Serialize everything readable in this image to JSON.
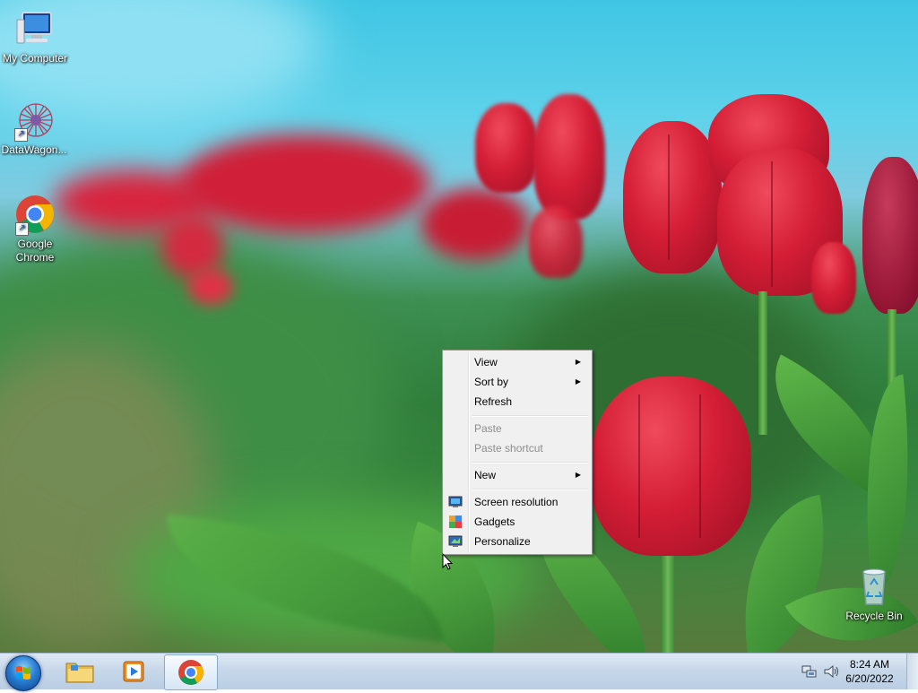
{
  "desktop": {
    "icons": [
      {
        "label": "My Computer",
        "icon": "computer-icon"
      },
      {
        "label": "DataWagon...",
        "icon": "datawagon-icon"
      },
      {
        "label": "Google Chrome",
        "icon": "chrome-icon"
      },
      {
        "label": "Recycle Bin",
        "icon": "recycle-bin-icon"
      }
    ]
  },
  "context_menu": {
    "items": [
      {
        "label": "View",
        "submenu": true,
        "enabled": true
      },
      {
        "label": "Sort by",
        "submenu": true,
        "enabled": true
      },
      {
        "label": "Refresh",
        "submenu": false,
        "enabled": true
      },
      {
        "label": "Paste",
        "submenu": false,
        "enabled": false
      },
      {
        "label": "Paste shortcut",
        "submenu": false,
        "enabled": false
      },
      {
        "label": "New",
        "submenu": true,
        "enabled": true
      },
      {
        "label": "Screen resolution",
        "icon": "monitor-icon",
        "enabled": true
      },
      {
        "label": "Gadgets",
        "icon": "gadgets-icon",
        "enabled": true
      },
      {
        "label": "Personalize",
        "icon": "personalize-icon",
        "enabled": true
      }
    ],
    "submenu_glyph": "▶"
  },
  "taskbar": {
    "pinned": [
      "start-button",
      "file-explorer-icon",
      "media-player-icon",
      "chrome-icon"
    ],
    "active": "chrome-icon",
    "clock": {
      "time": "8:24 AM",
      "date": "6/20/2022"
    }
  }
}
